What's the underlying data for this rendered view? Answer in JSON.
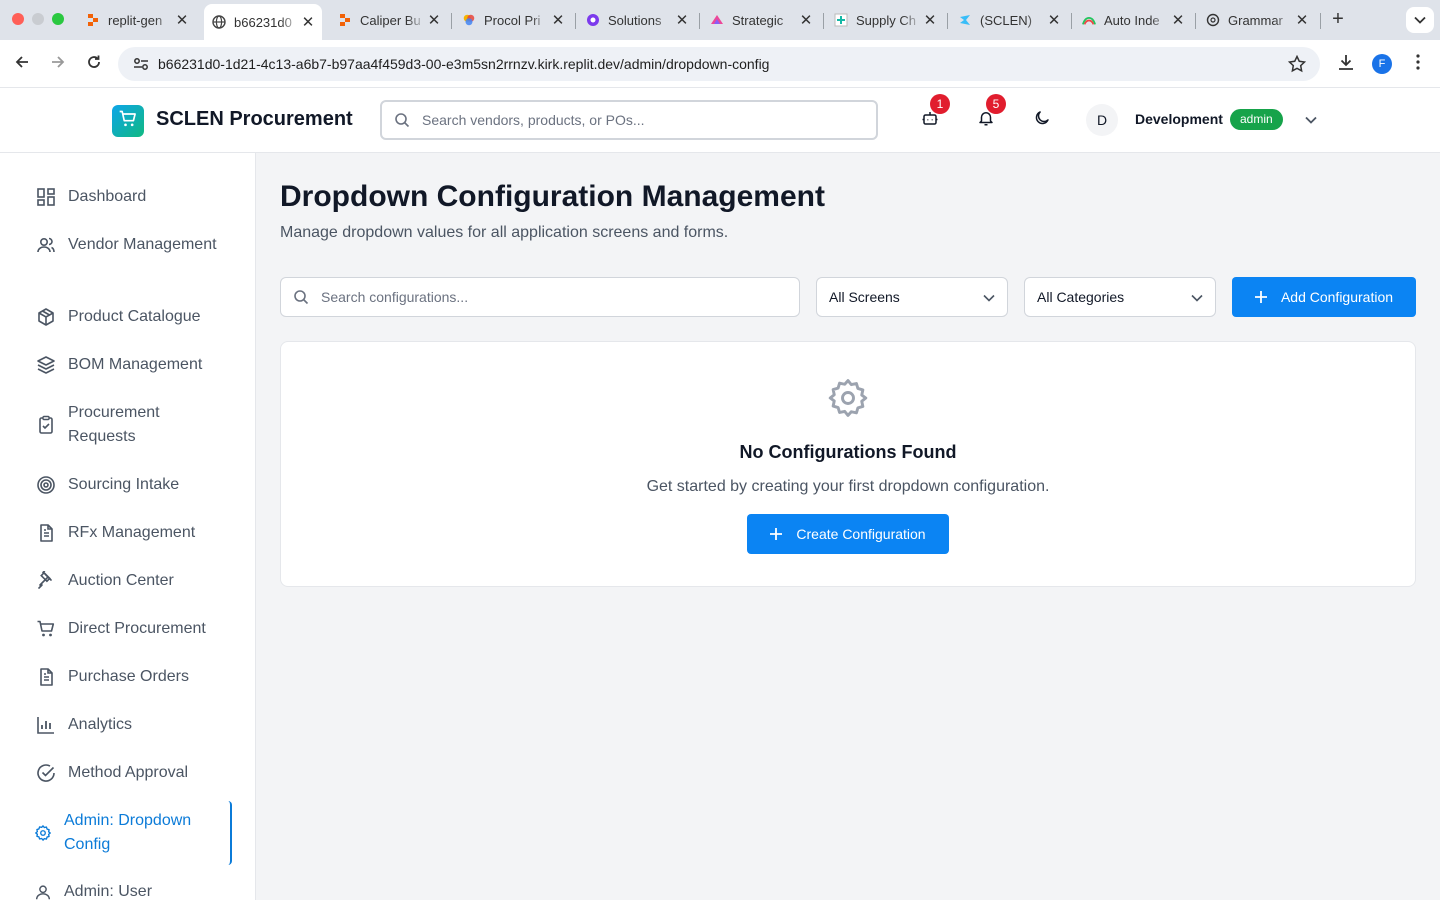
{
  "browser": {
    "tabs": [
      {
        "title": "replit-gen",
        "icon": "replit-icon"
      },
      {
        "title": "b66231d0",
        "icon": "globe-icon",
        "active": true
      },
      {
        "title": "Caliper Bu",
        "icon": "replit-icon"
      },
      {
        "title": "Procol Pri",
        "icon": "procol-icon"
      },
      {
        "title": "Solutions",
        "icon": "solutions-icon"
      },
      {
        "title": "Strategic",
        "icon": "strategic-icon"
      },
      {
        "title": "Supply Ch",
        "icon": "supply-icon"
      },
      {
        "title": "(SCLEN)",
        "icon": "sclen-icon"
      },
      {
        "title": "Auto Inde",
        "icon": "auto-icon"
      },
      {
        "title": "Grammar",
        "icon": "openai-icon"
      }
    ],
    "url": "b66231d0-1d21-4c13-a6b7-b97aa4f459d3-00-e3m5sn2rrnzv.kirk.replit.dev/admin/dropdown-config",
    "profile_initial": "F"
  },
  "header": {
    "brand": "SCLEN Procurement",
    "search_placeholder": "Search vendors, products, or POs...",
    "bot_badge": "1",
    "notification_badge": "5",
    "avatar_initial": "D",
    "user_name": "Development",
    "role": "admin"
  },
  "sidebar": {
    "items": [
      {
        "label": "Dashboard",
        "icon": "dashboard-icon"
      },
      {
        "label": "Vendor Management",
        "icon": "users-icon"
      },
      {
        "label": "Product Catalogue",
        "icon": "package-icon"
      },
      {
        "label": "BOM Management",
        "icon": "layers-icon"
      },
      {
        "label": "Procurement Requests",
        "icon": "clipboard-check-icon"
      },
      {
        "label": "Sourcing Intake",
        "icon": "target-icon"
      },
      {
        "label": "RFx Management",
        "icon": "file-text-icon"
      },
      {
        "label": "Auction Center",
        "icon": "gavel-icon"
      },
      {
        "label": "Direct Procurement",
        "icon": "cart-icon"
      },
      {
        "label": "Purchase Orders",
        "icon": "file-text-icon"
      },
      {
        "label": "Analytics",
        "icon": "bar-chart-icon"
      },
      {
        "label": "Method Approval",
        "icon": "check-circle-icon"
      },
      {
        "label": "Admin: Dropdown Config",
        "icon": "gear-icon",
        "active": true
      },
      {
        "label": "Admin: User",
        "icon": "user-icon"
      }
    ]
  },
  "main": {
    "title": "Dropdown Configuration Management",
    "subtitle": "Manage dropdown values for all application screens and forms.",
    "search_placeholder": "Search configurations...",
    "screen_filter": "All Screens",
    "category_filter": "All Categories",
    "add_button": "Add Configuration",
    "empty_title": "No Configurations Found",
    "empty_text": "Get started by creating your first dropdown configuration.",
    "create_button": "Create Configuration"
  },
  "colors": {
    "accent": "#0b84f3",
    "active_nav": "#0b7bd8",
    "badge": "#e11d2e",
    "role_badge": "#16a34a"
  }
}
